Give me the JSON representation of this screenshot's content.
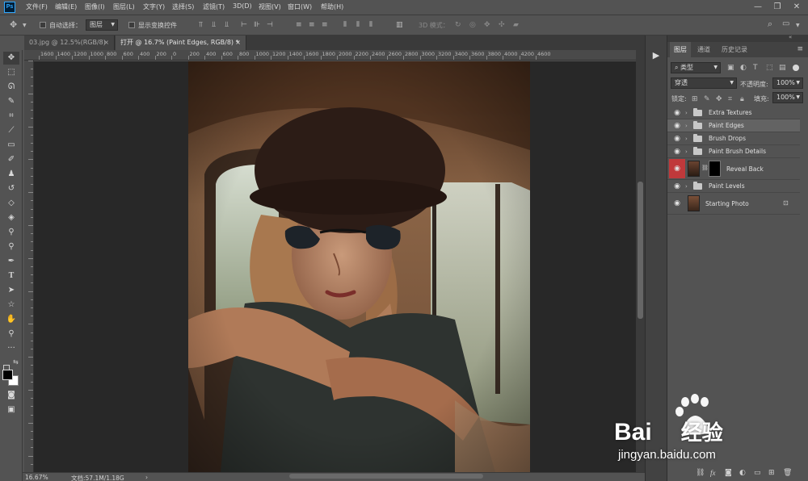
{
  "app": {
    "logo_text": "Ps"
  },
  "menu": {
    "items": [
      "文件(F)",
      "编辑(E)",
      "图像(I)",
      "图层(L)",
      "文字(Y)",
      "选择(S)",
      "滤镜(T)",
      "3D(D)",
      "视图(V)",
      "窗口(W)",
      "帮助(H)"
    ]
  },
  "window_controls": {
    "minimize": "—",
    "restore": "❐",
    "close": "✕"
  },
  "options_bar": {
    "auto_select_label": "自动选择：",
    "auto_select_target": "图层",
    "show_transform_label": "显示变换控件",
    "mode_3d_label": "3D 模式："
  },
  "tabs": [
    {
      "label": "03.jpg @ 12.5%(RGB/8)",
      "close": "×",
      "active": false
    },
    {
      "label": "打开 @ 16.7% (Paint Edges, RGB/8) *",
      "close": "×",
      "active": true
    }
  ],
  "ruler": {
    "top_ticks": [
      "1600",
      "1400",
      "1200",
      "1000",
      "800",
      "600",
      "400",
      "200",
      "0",
      "200",
      "400",
      "600",
      "800",
      "1000",
      "1200",
      "1400",
      "1600",
      "1800",
      "2000",
      "2200",
      "2400",
      "2600",
      "2800",
      "3000",
      "3200",
      "3400",
      "3600",
      "3800",
      "4000",
      "4200",
      "4600"
    ]
  },
  "status": {
    "zoom": "16.67%",
    "doc_size": "文档:57.1M/1.18G",
    "arrow": "›"
  },
  "layers_panel": {
    "tabs": [
      "图层",
      "通道",
      "历史记录"
    ],
    "active_tab": "图层",
    "filter_label": "类型",
    "blend_mode": "穿透",
    "opacity_label": "不透明度:",
    "opacity_value": "100%",
    "lock_label": "锁定:",
    "fill_label": "填充:",
    "fill_value": "100%",
    "layers": [
      {
        "name": "Extra Textures",
        "type": "group",
        "selected": false
      },
      {
        "name": "Paint Edges",
        "type": "group",
        "selected": true
      },
      {
        "name": "Brush Drops",
        "type": "group",
        "selected": false
      },
      {
        "name": "Paint Brush Details",
        "type": "group",
        "selected": false
      },
      {
        "name": "Reveal Back",
        "type": "masked-layer",
        "selected": false
      },
      {
        "name": "Paint Levels",
        "type": "group",
        "selected": false
      },
      {
        "name": "Starting Photo",
        "type": "locked-layer",
        "selected": false
      }
    ],
    "bottom_icons": [
      "link-icon",
      "fx-icon",
      "mask-icon",
      "adjustment-icon",
      "folder-icon",
      "new-layer-icon",
      "trash-icon"
    ]
  },
  "watermark": {
    "brand": "Bai",
    "brand_suffix": "经验",
    "url": "jingyan.baidu.com"
  }
}
